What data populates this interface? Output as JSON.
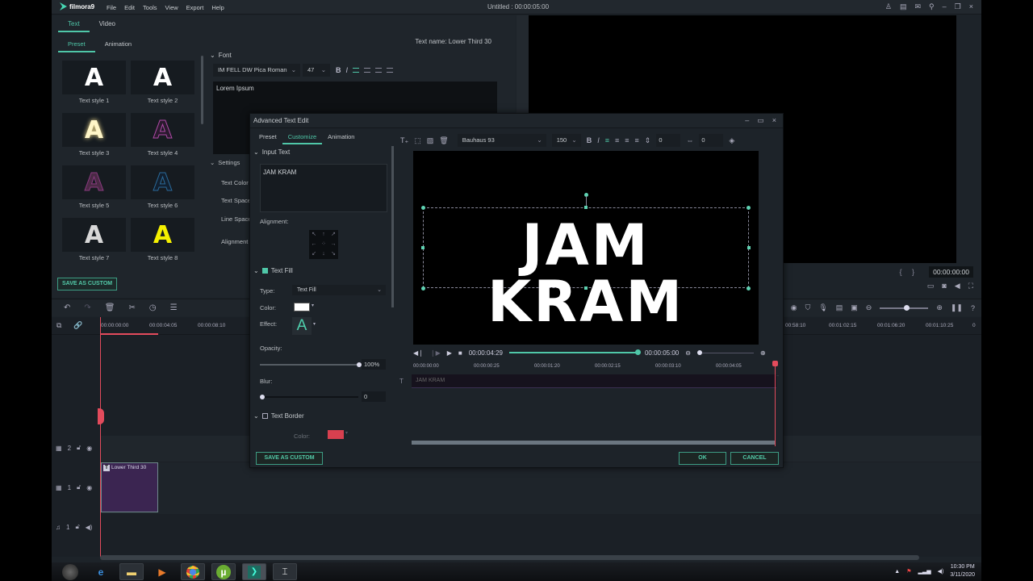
{
  "app": {
    "name": "filmora9",
    "menu": [
      "File",
      "Edit",
      "Tools",
      "View",
      "Export",
      "Help"
    ],
    "window_title": "Untitled : 00:00:05:00",
    "window_icons": [
      "account-icon",
      "documents-icon",
      "mail-icon",
      "microphone-icon",
      "minimize-icon",
      "restore-icon",
      "close-icon"
    ]
  },
  "left_panel": {
    "tabs": [
      {
        "label": "Text",
        "active": true
      },
      {
        "label": "Video",
        "active": false
      }
    ],
    "subtabs": [
      {
        "label": "Preset",
        "active": true
      },
      {
        "label": "Animation",
        "active": false
      }
    ],
    "text_name": "Text name: Lower Third 30",
    "styles": [
      {
        "label": "Text style 1",
        "color": "#ffffff"
      },
      {
        "label": "Text style 2",
        "color": "#ffffff"
      },
      {
        "label": "Text style 3",
        "color": "#fff6c8"
      },
      {
        "label": "Text style 4",
        "color": "#2a1a2e"
      },
      {
        "label": "Text style 5",
        "color": "#4a2a45"
      },
      {
        "label": "Text style 6",
        "color": "#122030"
      },
      {
        "label": "Text style 7",
        "color": "#d8d8d8"
      },
      {
        "label": "Text style 8",
        "color": "#f5f000"
      }
    ],
    "glyph": "A",
    "save_custom": "SAVE AS CUSTOM",
    "font_section": "Font",
    "font_name": "IM FELL DW Pica Roman",
    "font_size": "47",
    "text_value": "Lorem Ipsum",
    "settings_section": "Settings",
    "settings_items": [
      "Text Color",
      "Text Space",
      "Line Space",
      "Alignment"
    ]
  },
  "preview": {
    "timecode": "00:00:00:00"
  },
  "timeline": {
    "ruler_ticks": [
      "00:00:00:00",
      "00:00:04:05",
      "00:00:08:10",
      "00:58:10",
      "00:01:02:15",
      "00:01:06:20",
      "00:01:10:25",
      "0"
    ],
    "tracks": [
      {
        "label": "2",
        "type": "video"
      },
      {
        "label": "1",
        "type": "video"
      },
      {
        "label": "1",
        "type": "audio"
      }
    ],
    "clip_label": "Lower Third 30"
  },
  "dialog": {
    "title": "Advanced Text Edit",
    "tabs": [
      {
        "label": "Preset",
        "active": false
      },
      {
        "label": "Customize",
        "active": true
      },
      {
        "label": "Animation",
        "active": false
      }
    ],
    "input_section": "Input Text",
    "input_value": "JAM KRAM",
    "alignment_label": "Alignment:",
    "text_fill_section": "Text Fill",
    "text_fill_checked": true,
    "type_label": "Type:",
    "type_value": "Text Fill",
    "color_label": "Color:",
    "fill_color": "#ffffff",
    "effect_label": "Effect:",
    "effect_glyph": "A",
    "opacity_label": "Opacity:",
    "opacity_value": "100%",
    "opacity_fraction": 1.0,
    "blur_label": "Blur:",
    "blur_value": "0",
    "blur_fraction": 0,
    "text_border_section": "Text Border",
    "text_border_checked": false,
    "border_color_label": "Color:",
    "border_color": "#d8404f",
    "font_name": "Bauhaus 93",
    "font_size": "150",
    "char_spacing": "0",
    "line_spacing": "0",
    "canvas_text": "JAM KRAM",
    "current_time": "00:00:04:29",
    "duration": "00:00:05:00",
    "progress_fraction": 0.99,
    "ruler_ticks": [
      "00:00:00:00",
      "00:00:00:25",
      "00:00:01:20",
      "00:00:02:15",
      "00:00:03:10",
      "00:00:04:05"
    ],
    "track_text": "JAM KRAM",
    "save_custom": "SAVE AS CUSTOM",
    "ok": "OK",
    "cancel": "CANCEL"
  },
  "taskbar": {
    "apps": [
      "start-orb",
      "internet-explorer",
      "file-explorer",
      "media-player",
      "chrome",
      "utorrent",
      "filmora",
      "snipping-tool"
    ],
    "time": "10:30 PM",
    "date": "3/11/2020"
  },
  "colors": {
    "accent": "#4fc7a8",
    "playhead": "#e34b5c",
    "clip": "#3b2551"
  }
}
